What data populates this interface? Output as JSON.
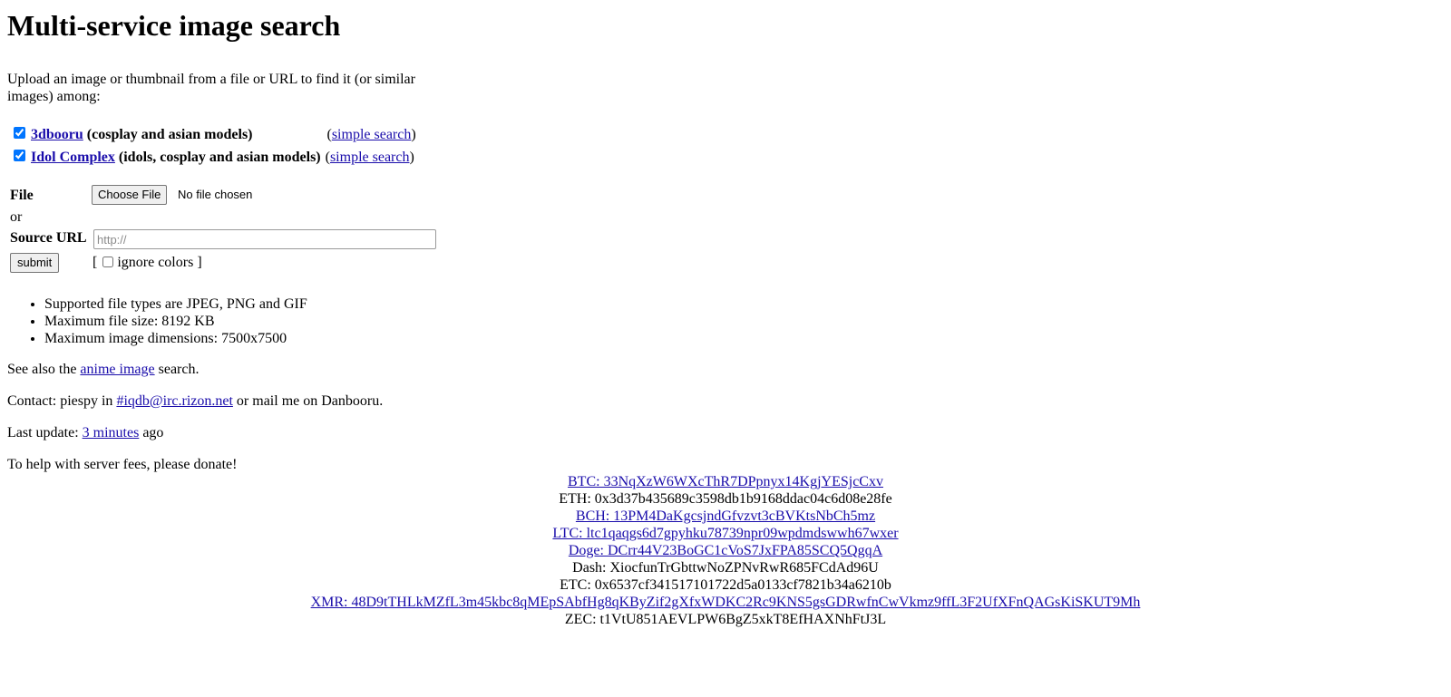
{
  "title": "Multi-service image search",
  "intro": "Upload an image or thumbnail from a file or URL to find it (or similar images) among:",
  "services": [
    {
      "name": "3dbooru",
      "desc": "(cosplay and asian models)",
      "checked": true,
      "simple_label": "simple search"
    },
    {
      "name": "Idol Complex",
      "desc": "(idols, cosplay and asian models)",
      "checked": true,
      "simple_label": "simple search"
    }
  ],
  "form": {
    "file_label": "File",
    "file_button": "Choose File",
    "file_state": "No file chosen",
    "or_label": "or",
    "url_label": "Source URL",
    "url_placeholder": "http://",
    "submit_label": "submit",
    "ignore_colors_label": "ignore colors"
  },
  "notes": [
    "Supported file types are JPEG, PNG and GIF",
    "Maximum file size: 8192 KB",
    "Maximum image dimensions: 7500x7500"
  ],
  "see_also": {
    "prefix": "See also the",
    "link": "anime image",
    "suffix": "search."
  },
  "contact": {
    "prefix": "Contact: piespy in",
    "link": "#iqdb@irc.rizon.net",
    "suffix": "or mail me on Danbooru."
  },
  "last_update": {
    "prefix": "Last update:",
    "link": "3 minutes",
    "suffix": "ago"
  },
  "donate_text": "To help with server fees, please donate!",
  "donations": [
    {
      "text": "BTC: 33NqXzW6WXcThR7DPpnyx14KgjYESjcCxv",
      "link": true
    },
    {
      "text": "ETH: 0x3d37b435689c3598db1b9168ddac04c6d08e28fe",
      "link": false
    },
    {
      "text": "BCH: 13PM4DaKgcsjndGfvzvt3cBVKtsNbCh5mz",
      "link": true
    },
    {
      "text": "LTC: ltc1qaqgs6d7gpyhku78739npr09wpdmdswwh67wxer",
      "link": true
    },
    {
      "text": "Doge: DCrr44V23BoGC1cVoS7JxFPA85SCQ5QgqA",
      "link": true
    },
    {
      "text": "Dash: XiocfunTrGbttwNoZPNvRwR685FCdAd96U",
      "link": false
    },
    {
      "text": "ETC: 0x6537cf341517101722d5a0133cf7821b34a6210b",
      "link": false
    },
    {
      "text": "XMR: 48D9tTHLkMZfL3m45kbc8qMEpSAbfHg8qKByZif2gXfxWDKC2Rc9KNS5gsGDRwfnCwVkmz9ffL3F2UfXFnQAGsKiSKUT9Mh",
      "link": true
    },
    {
      "text": "ZEC: t1VtU851AEVLPW6BgZ5xkT8EfHAXNhFtJ3L",
      "link": false
    }
  ]
}
